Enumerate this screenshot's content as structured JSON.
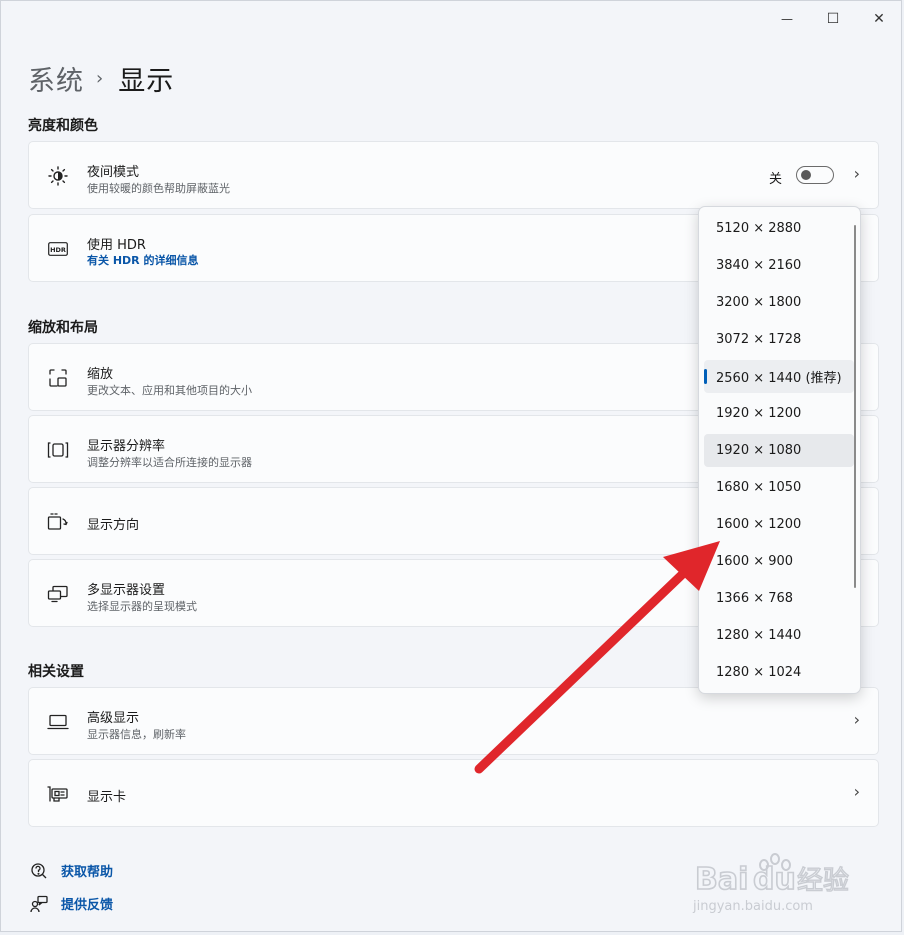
{
  "window": {
    "minimize": "—",
    "maximize": "☐",
    "close": "✕"
  },
  "breadcrumb": {
    "parent": "系统",
    "separator": "›",
    "current": "显示"
  },
  "sections": {
    "brightness": "亮度和颜色",
    "scale_layout": "缩放和布局",
    "related": "相关设置"
  },
  "night_mode": {
    "title": "夜间模式",
    "subtitle": "使用较暖的颜色帮助屏蔽蓝光",
    "toggle_state": "关",
    "icon": "brightness-icon"
  },
  "hdr": {
    "title": "使用 HDR",
    "link": "有关 HDR 的详细信息",
    "icon": "hdr-icon"
  },
  "scale": {
    "title": "缩放",
    "subtitle": "更改文本、应用和其他项目的大小",
    "icon": "scale-icon"
  },
  "resolution": {
    "title": "显示器分辨率",
    "subtitle": "调整分辨率以适合所连接的显示器",
    "icon": "resolution-icon"
  },
  "orientation": {
    "title": "显示方向",
    "icon": "orientation-icon"
  },
  "multi_display": {
    "title": "多显示器设置",
    "subtitle": "选择显示器的呈现模式",
    "icon": "multi-display-icon"
  },
  "advanced_display": {
    "title": "高级显示",
    "subtitle": "显示器信息，刷新率",
    "icon": "monitor-icon"
  },
  "graphics": {
    "title": "显示卡",
    "icon": "gpu-icon"
  },
  "resolution_options": [
    "5120 × 2880",
    "3840 × 2160",
    "3200 × 1800",
    "3072 × 1728",
    "2560 × 1440 (推荐)",
    "1920 × 1200",
    "1920 × 1080",
    "1680 × 1050",
    "1600 × 1200",
    "1600 × 900",
    "1366 × 768",
    "1280 × 1440",
    "1280 × 1024"
  ],
  "selected_resolution": "2560 × 1440 (推荐)",
  "footer": {
    "help": "获取帮助",
    "feedback": "提供反馈"
  },
  "watermark": {
    "brand": "Baidu经验",
    "url": "jingyan.baidu.com"
  },
  "colors": {
    "accent": "#005fb8",
    "link": "#0a56a8",
    "arrow": "#e0262b"
  }
}
